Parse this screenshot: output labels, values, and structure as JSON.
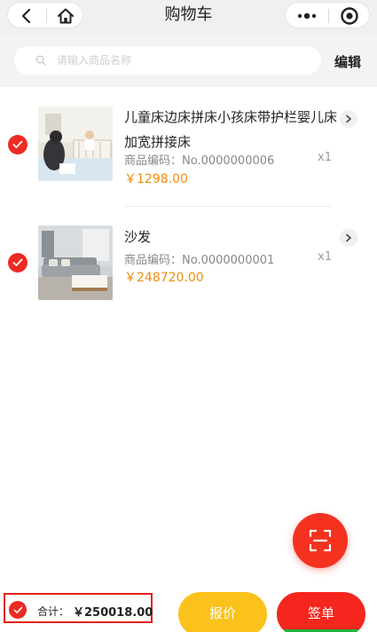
{
  "nav": {
    "title": "购物车",
    "back_icon": "chevron-left-icon",
    "home_icon": "home-icon",
    "more_icon": "more-dots-icon",
    "target_icon": "target-icon"
  },
  "search": {
    "placeholder": "请输入商品名称",
    "value": "",
    "edit_label": "编辑"
  },
  "items": [
    {
      "name": "儿童床边床拼床小孩床带护栏婴儿床加宽拼接床",
      "code": "商品编码：No.0000000006",
      "quantity": "x1",
      "price": "￥1298.00",
      "checked": true
    },
    {
      "name": "沙发",
      "code": "商品编码：No.0000000001",
      "quantity": "x1",
      "price": "￥248720.00",
      "checked": true
    }
  ],
  "fab": {
    "icon": "scan-icon"
  },
  "footer": {
    "total_label": "合计：",
    "total_value": "￥250018.00",
    "quote_label": "报价",
    "order_label": "签单"
  },
  "colors": {
    "accent_red": "#ee2a24",
    "price_orange": "#f08c10",
    "quote_yellow": "#fbc21b",
    "highlight_border": "#e2231a"
  }
}
